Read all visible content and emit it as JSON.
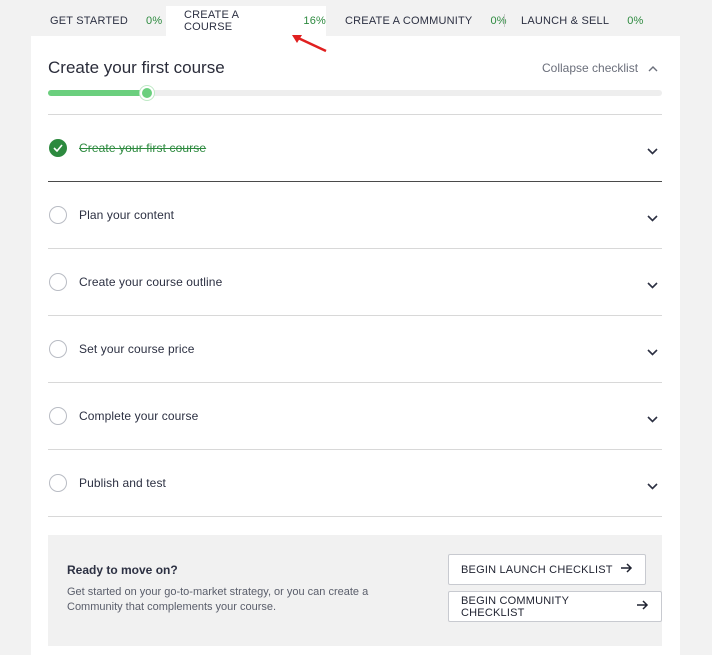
{
  "tabs": [
    {
      "label": "GET STARTED",
      "pct": "0%"
    },
    {
      "label": "CREATE A COURSE",
      "pct": "16%"
    },
    {
      "label": "CREATE A COMMUNITY",
      "pct": "0%"
    },
    {
      "label": "LAUNCH & SELL",
      "pct": "0%"
    }
  ],
  "checklist": {
    "title": "Create your first course",
    "collapse_label": "Collapse checklist",
    "progress": 0.16,
    "items": [
      {
        "label": "Create your first course",
        "done": true
      },
      {
        "label": "Plan your content",
        "done": false
      },
      {
        "label": "Create your course outline",
        "done": false
      },
      {
        "label": "Set your course price",
        "done": false
      },
      {
        "label": "Complete your course",
        "done": false
      },
      {
        "label": "Publish and test",
        "done": false
      }
    ]
  },
  "cta": {
    "heading": "Ready to move on?",
    "description": "Get started on your go-to-market strategy, or you can create a Community that complements your course.",
    "launch_button": "BEGIN LAUNCH CHECKLIST",
    "community_button": "BEGIN COMMUNITY CHECKLIST"
  },
  "colors": {
    "accent": "#2d8a3f",
    "progress": "#6bcf7e",
    "annotation": "#e02020"
  }
}
